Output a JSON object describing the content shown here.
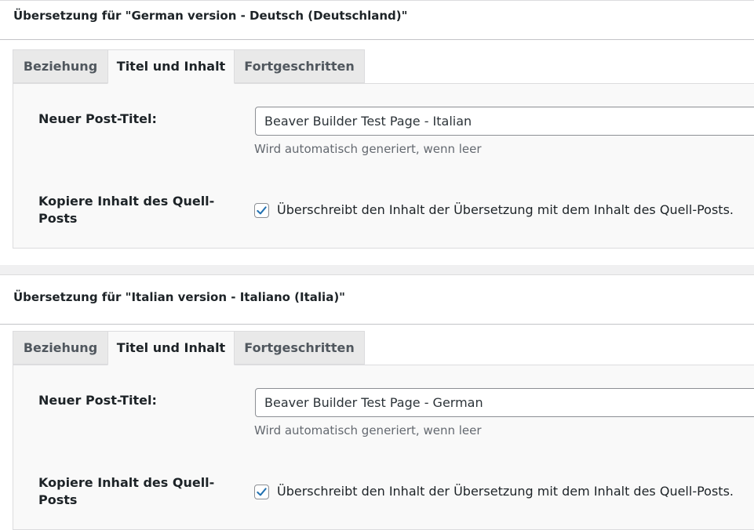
{
  "sections": [
    {
      "title": "Übersetzung für \"German version - Deutsch (Deutschland)\"",
      "tabs": [
        "Beziehung",
        "Titel und Inhalt",
        "Fortgeschritten"
      ],
      "active_tab": "Titel und Inhalt",
      "title_label": "Neuer Post-Titel:",
      "title_value": "Beaver Builder Test Page - Italian",
      "title_hint": "Wird automatisch generiert, wenn leer",
      "copy_label": "Kopiere Inhalt des Quell-Posts",
      "copy_checked": true,
      "copy_description": "Überschreibt den Inhalt der Übersetzung mit dem Inhalt des Quell-Posts."
    },
    {
      "title": "Übersetzung für \"Italian version - Italiano (Italia)\"",
      "tabs": [
        "Beziehung",
        "Titel und Inhalt",
        "Fortgeschritten"
      ],
      "active_tab": "Titel und Inhalt",
      "title_label": "Neuer Post-Titel:",
      "title_value": "Beaver Builder Test Page - German",
      "title_hint": "Wird automatisch generiert, wenn leer",
      "copy_label": "Kopiere Inhalt des Quell-Posts",
      "copy_checked": true,
      "copy_description": "Überschreibt den Inhalt der Übersetzung mit dem Inhalt des Quell-Posts."
    }
  ],
  "colors": {
    "check": "#2271b1",
    "active_tab_bg": "#f9f9f9",
    "inactive_tab_bg": "#e9e9e9"
  }
}
